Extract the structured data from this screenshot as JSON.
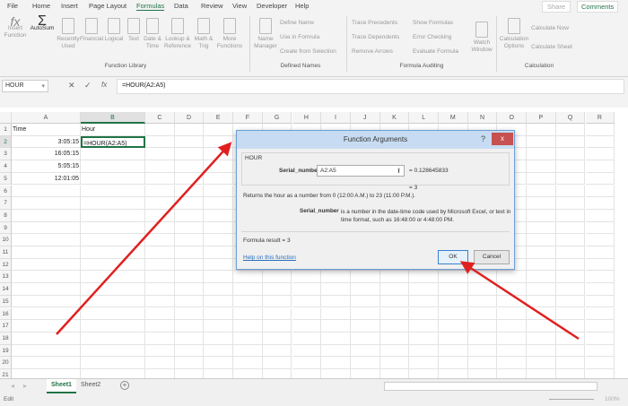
{
  "tabs": [
    "File",
    "Home",
    "Insert",
    "Page Layout",
    "Formulas",
    "Data",
    "Review",
    "View",
    "Developer",
    "Help"
  ],
  "active_tab": "Formulas",
  "share": "Share",
  "comments": "Comments",
  "ribbon": {
    "insert_function": "Insert Function",
    "autosum": "AutoSum",
    "recently_used": "Recently Used",
    "financial": "Financial",
    "logical": "Logical",
    "text": "Text",
    "date_time": "Date & Time",
    "lookup": "Lookup & Reference",
    "math": "Math & Trig",
    "more": "More Functions",
    "function_library": "Function Library",
    "name_manager": "Name Manager",
    "define_name": "Define Name",
    "use_in_formula": "Use in Formula",
    "create_from_selection": "Create from Selection",
    "defined_names": "Defined Names",
    "trace_precedents": "Trace Precedents",
    "trace_dependents": "Trace Dependents",
    "remove_arrows": "Remove Arrows",
    "show_formulas": "Show Formulas",
    "error_checking": "Error Checking",
    "evaluate_formula": "Evaluate Formula",
    "formula_auditing": "Formula Auditing",
    "watch_window": "Watch Window",
    "calc_options": "Calculation Options",
    "calc_now": "Calculate Now",
    "calc_sheet": "Calculate Sheet",
    "calculation": "Calculation"
  },
  "formula_bar": {
    "name_box": "HOUR",
    "cancel": "✕",
    "enter": "✓",
    "fx": "fx",
    "formula": "=HOUR(A2:A5)"
  },
  "columns": [
    "A",
    "B",
    "C",
    "D",
    "E",
    "F",
    "G",
    "H",
    "I",
    "J",
    "K",
    "L",
    "M",
    "N",
    "O",
    "P",
    "Q",
    "R"
  ],
  "rows": [
    {
      "A": "Time",
      "B": "Hour"
    },
    {
      "A": "3:05:15",
      "B": "=HOUR(A2:A5)"
    },
    {
      "A": "16:05:15",
      "B": ""
    },
    {
      "A": "5:05:15",
      "B": ""
    },
    {
      "A": "12:01:05",
      "B": ""
    }
  ],
  "dialog": {
    "title": "Function Arguments",
    "help": "?",
    "close": "x",
    "function_name": "HOUR",
    "arg_label": "Serial_number",
    "arg_value": "A2:A5",
    "arg_result": "=  0.128645833",
    "result_eq": "=  3",
    "description": "Returns the hour as a number from 0 (12:00 A.M.) to 23 (11:00 P.M.).",
    "arg_name_bold": "Serial_number",
    "arg_desc": "is a number in the date-time code used by Microsoft Excel, or text in time format, such as 16:48:00 or 4:48:00 PM.",
    "formula_result": "Formula result =   3",
    "help_link": "Help on this function",
    "ok": "OK",
    "cancel": "Cancel"
  },
  "sheets": [
    "Sheet1",
    "Sheet2"
  ],
  "active_sheet": "Sheet1",
  "status": {
    "mode": "Edit",
    "zoom": "100%"
  },
  "annotation_color": "#e02020"
}
